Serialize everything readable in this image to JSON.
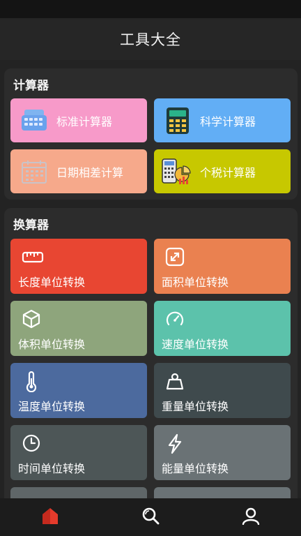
{
  "app": {
    "title": "工具大全"
  },
  "calculators": {
    "title": "计算器",
    "items": [
      {
        "label": "标准计算器",
        "icon": "calculator-keypad-icon",
        "color": "#f79ac9"
      },
      {
        "label": "科学计算器",
        "icon": "scientific-calculator-icon",
        "color": "#62aef5"
      },
      {
        "label": "日期相差计算",
        "icon": "calendar-icon",
        "color": "#f6a98b"
      },
      {
        "label": "个税计算器",
        "icon": "tax-calculator-icon",
        "color": "#c7c800"
      }
    ]
  },
  "converters": {
    "title": "换算器",
    "items": [
      {
        "label": "长度单位转换",
        "icon": "ruler-icon",
        "color": "#e84632"
      },
      {
        "label": "面积单位转换",
        "icon": "expand-arrows-icon",
        "color": "#ea8150"
      },
      {
        "label": "体积单位转换",
        "icon": "cube-icon",
        "color": "#8ea57c"
      },
      {
        "label": "速度单位转换",
        "icon": "speedometer-icon",
        "color": "#5cc2ab"
      },
      {
        "label": "温度单位转换",
        "icon": "thermometer-icon",
        "color": "#4c6a9e"
      },
      {
        "label": "重量单位转换",
        "icon": "weight-icon",
        "color": "#3f4a4d"
      },
      {
        "label": "时间单位转换",
        "icon": "clock-icon",
        "color": "#4d5657"
      },
      {
        "label": "能量单位转换",
        "icon": "lightning-icon",
        "color": "#6a7275"
      }
    ]
  },
  "bottom_nav": [
    {
      "name": "home",
      "icon": "home-icon",
      "active": true,
      "color": "#e53b2c"
    },
    {
      "name": "search",
      "icon": "search-icon",
      "active": false,
      "color": "#ffffff"
    },
    {
      "name": "profile",
      "icon": "user-icon",
      "active": false,
      "color": "#ffffff"
    }
  ]
}
